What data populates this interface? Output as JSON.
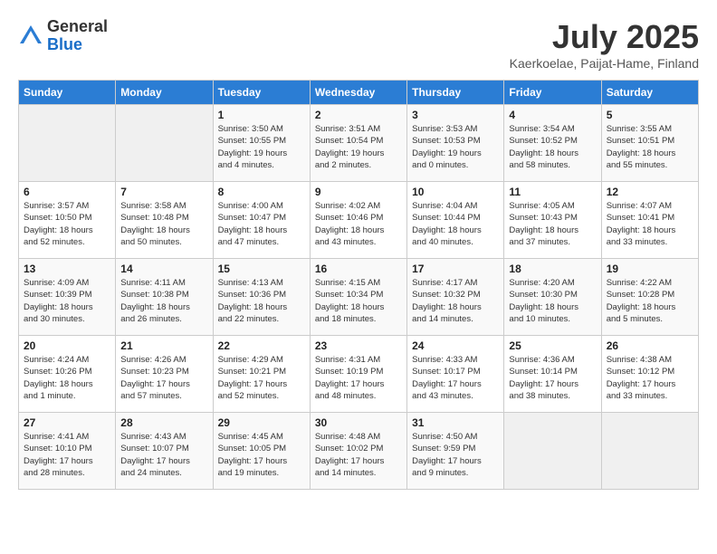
{
  "header": {
    "logo_general": "General",
    "logo_blue": "Blue",
    "month": "July 2025",
    "subtitle": "Kaerkoelae, Paijat-Hame, Finland"
  },
  "days_of_week": [
    "Sunday",
    "Monday",
    "Tuesday",
    "Wednesday",
    "Thursday",
    "Friday",
    "Saturday"
  ],
  "weeks": [
    [
      {
        "day": "",
        "info": ""
      },
      {
        "day": "",
        "info": ""
      },
      {
        "day": "1",
        "info": "Sunrise: 3:50 AM\nSunset: 10:55 PM\nDaylight: 19 hours\nand 4 minutes."
      },
      {
        "day": "2",
        "info": "Sunrise: 3:51 AM\nSunset: 10:54 PM\nDaylight: 19 hours\nand 2 minutes."
      },
      {
        "day": "3",
        "info": "Sunrise: 3:53 AM\nSunset: 10:53 PM\nDaylight: 19 hours\nand 0 minutes."
      },
      {
        "day": "4",
        "info": "Sunrise: 3:54 AM\nSunset: 10:52 PM\nDaylight: 18 hours\nand 58 minutes."
      },
      {
        "day": "5",
        "info": "Sunrise: 3:55 AM\nSunset: 10:51 PM\nDaylight: 18 hours\nand 55 minutes."
      }
    ],
    [
      {
        "day": "6",
        "info": "Sunrise: 3:57 AM\nSunset: 10:50 PM\nDaylight: 18 hours\nand 52 minutes."
      },
      {
        "day": "7",
        "info": "Sunrise: 3:58 AM\nSunset: 10:48 PM\nDaylight: 18 hours\nand 50 minutes."
      },
      {
        "day": "8",
        "info": "Sunrise: 4:00 AM\nSunset: 10:47 PM\nDaylight: 18 hours\nand 47 minutes."
      },
      {
        "day": "9",
        "info": "Sunrise: 4:02 AM\nSunset: 10:46 PM\nDaylight: 18 hours\nand 43 minutes."
      },
      {
        "day": "10",
        "info": "Sunrise: 4:04 AM\nSunset: 10:44 PM\nDaylight: 18 hours\nand 40 minutes."
      },
      {
        "day": "11",
        "info": "Sunrise: 4:05 AM\nSunset: 10:43 PM\nDaylight: 18 hours\nand 37 minutes."
      },
      {
        "day": "12",
        "info": "Sunrise: 4:07 AM\nSunset: 10:41 PM\nDaylight: 18 hours\nand 33 minutes."
      }
    ],
    [
      {
        "day": "13",
        "info": "Sunrise: 4:09 AM\nSunset: 10:39 PM\nDaylight: 18 hours\nand 30 minutes."
      },
      {
        "day": "14",
        "info": "Sunrise: 4:11 AM\nSunset: 10:38 PM\nDaylight: 18 hours\nand 26 minutes."
      },
      {
        "day": "15",
        "info": "Sunrise: 4:13 AM\nSunset: 10:36 PM\nDaylight: 18 hours\nand 22 minutes."
      },
      {
        "day": "16",
        "info": "Sunrise: 4:15 AM\nSunset: 10:34 PM\nDaylight: 18 hours\nand 18 minutes."
      },
      {
        "day": "17",
        "info": "Sunrise: 4:17 AM\nSunset: 10:32 PM\nDaylight: 18 hours\nand 14 minutes."
      },
      {
        "day": "18",
        "info": "Sunrise: 4:20 AM\nSunset: 10:30 PM\nDaylight: 18 hours\nand 10 minutes."
      },
      {
        "day": "19",
        "info": "Sunrise: 4:22 AM\nSunset: 10:28 PM\nDaylight: 18 hours\nand 5 minutes."
      }
    ],
    [
      {
        "day": "20",
        "info": "Sunrise: 4:24 AM\nSunset: 10:26 PM\nDaylight: 18 hours\nand 1 minute."
      },
      {
        "day": "21",
        "info": "Sunrise: 4:26 AM\nSunset: 10:23 PM\nDaylight: 17 hours\nand 57 minutes."
      },
      {
        "day": "22",
        "info": "Sunrise: 4:29 AM\nSunset: 10:21 PM\nDaylight: 17 hours\nand 52 minutes."
      },
      {
        "day": "23",
        "info": "Sunrise: 4:31 AM\nSunset: 10:19 PM\nDaylight: 17 hours\nand 48 minutes."
      },
      {
        "day": "24",
        "info": "Sunrise: 4:33 AM\nSunset: 10:17 PM\nDaylight: 17 hours\nand 43 minutes."
      },
      {
        "day": "25",
        "info": "Sunrise: 4:36 AM\nSunset: 10:14 PM\nDaylight: 17 hours\nand 38 minutes."
      },
      {
        "day": "26",
        "info": "Sunrise: 4:38 AM\nSunset: 10:12 PM\nDaylight: 17 hours\nand 33 minutes."
      }
    ],
    [
      {
        "day": "27",
        "info": "Sunrise: 4:41 AM\nSunset: 10:10 PM\nDaylight: 17 hours\nand 28 minutes."
      },
      {
        "day": "28",
        "info": "Sunrise: 4:43 AM\nSunset: 10:07 PM\nDaylight: 17 hours\nand 24 minutes."
      },
      {
        "day": "29",
        "info": "Sunrise: 4:45 AM\nSunset: 10:05 PM\nDaylight: 17 hours\nand 19 minutes."
      },
      {
        "day": "30",
        "info": "Sunrise: 4:48 AM\nSunset: 10:02 PM\nDaylight: 17 hours\nand 14 minutes."
      },
      {
        "day": "31",
        "info": "Sunrise: 4:50 AM\nSunset: 9:59 PM\nDaylight: 17 hours\nand 9 minutes."
      },
      {
        "day": "",
        "info": ""
      },
      {
        "day": "",
        "info": ""
      }
    ]
  ]
}
